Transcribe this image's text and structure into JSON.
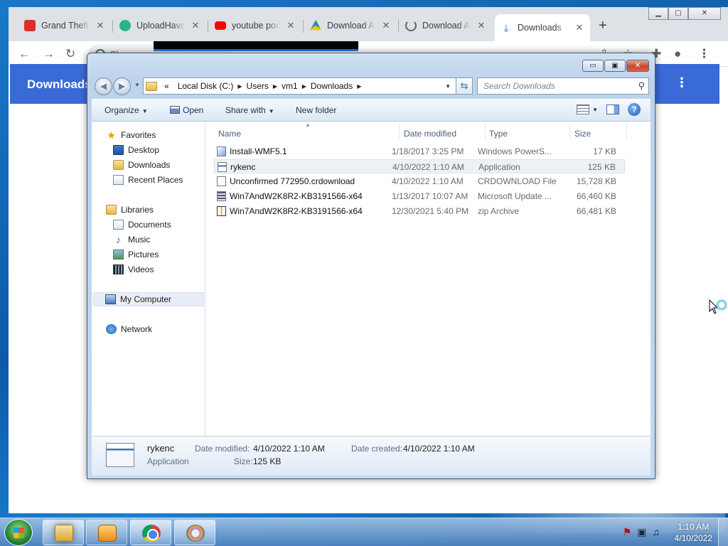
{
  "browser": {
    "tabs": [
      {
        "label": "Grand Theft A",
        "icon": "red-lock-icon"
      },
      {
        "label": "UploadHaven",
        "icon": "uploadhaven-icon"
      },
      {
        "label": "youtube podc",
        "icon": "youtube-icon"
      },
      {
        "label": "Download A",
        "icon": "drive-icon"
      },
      {
        "label": "Download A",
        "icon": "loading-icon"
      },
      {
        "label": "Downloads",
        "icon": "download-icon"
      }
    ],
    "new_tab_label": "+",
    "omnibox_text": "Chrome",
    "page_header_title": "Downloads",
    "menu_glyph": "⋮"
  },
  "explorer": {
    "caption_buttons": {
      "minimize": "▭",
      "maximize": "▣",
      "close": "✕"
    },
    "address": {
      "overflow": "«",
      "crumbs": [
        "Local Disk (C:)",
        "Users",
        "vm1",
        "Downloads"
      ]
    },
    "search_placeholder": "Search Downloads",
    "commands": {
      "organize": "Organize",
      "open": "Open",
      "share_with": "Share with",
      "new_folder": "New folder"
    },
    "nav": {
      "favorites": "Favorites",
      "desktop": "Desktop",
      "downloads": "Downloads",
      "recent_places": "Recent Places",
      "libraries": "Libraries",
      "documents": "Documents",
      "music": "Music",
      "pictures": "Pictures",
      "videos": "Videos",
      "my_computer": "My Computer",
      "network": "Network"
    },
    "columns": {
      "name": "Name",
      "date": "Date modified",
      "type": "Type",
      "size": "Size"
    },
    "files": [
      {
        "name": "Install-WMF5.1",
        "date": "1/18/2017 3:25 PM",
        "type": "Windows PowerS...",
        "size": "17 KB",
        "icon": "powershell-script-icon"
      },
      {
        "name": "rykenc",
        "date": "4/10/2022 1:10 AM",
        "type": "Application",
        "size": "125 KB",
        "icon": "application-icon"
      },
      {
        "name": "Unconfirmed 772950.crdownload",
        "date": "4/10/2022 1:10 AM",
        "type": "CRDOWNLOAD File",
        "size": "15,728 KB",
        "icon": "blank-file-icon"
      },
      {
        "name": "Win7AndW2K8R2-KB3191566-x64",
        "date": "1/13/2017 10:07 AM",
        "type": "Microsoft Update ...",
        "size": "66,460 KB",
        "icon": "update-package-icon"
      },
      {
        "name": "Win7AndW2K8R2-KB3191566-x64",
        "date": "12/30/2021 5:40 PM",
        "type": "zip Archive",
        "size": "66,481 KB",
        "icon": "zip-archive-icon"
      }
    ],
    "details": {
      "name": "rykenc",
      "type": "Application",
      "modified_label": "Date modified:",
      "modified_value": "4/10/2022 1:10 AM",
      "created_label": "Date created:",
      "created_value": "4/10/2022 1:10 AM",
      "size_label": "Size:",
      "size_value": "125 KB"
    }
  },
  "taskbar": {
    "clock_time": "1:10 AM",
    "clock_date": "4/10/2022"
  }
}
